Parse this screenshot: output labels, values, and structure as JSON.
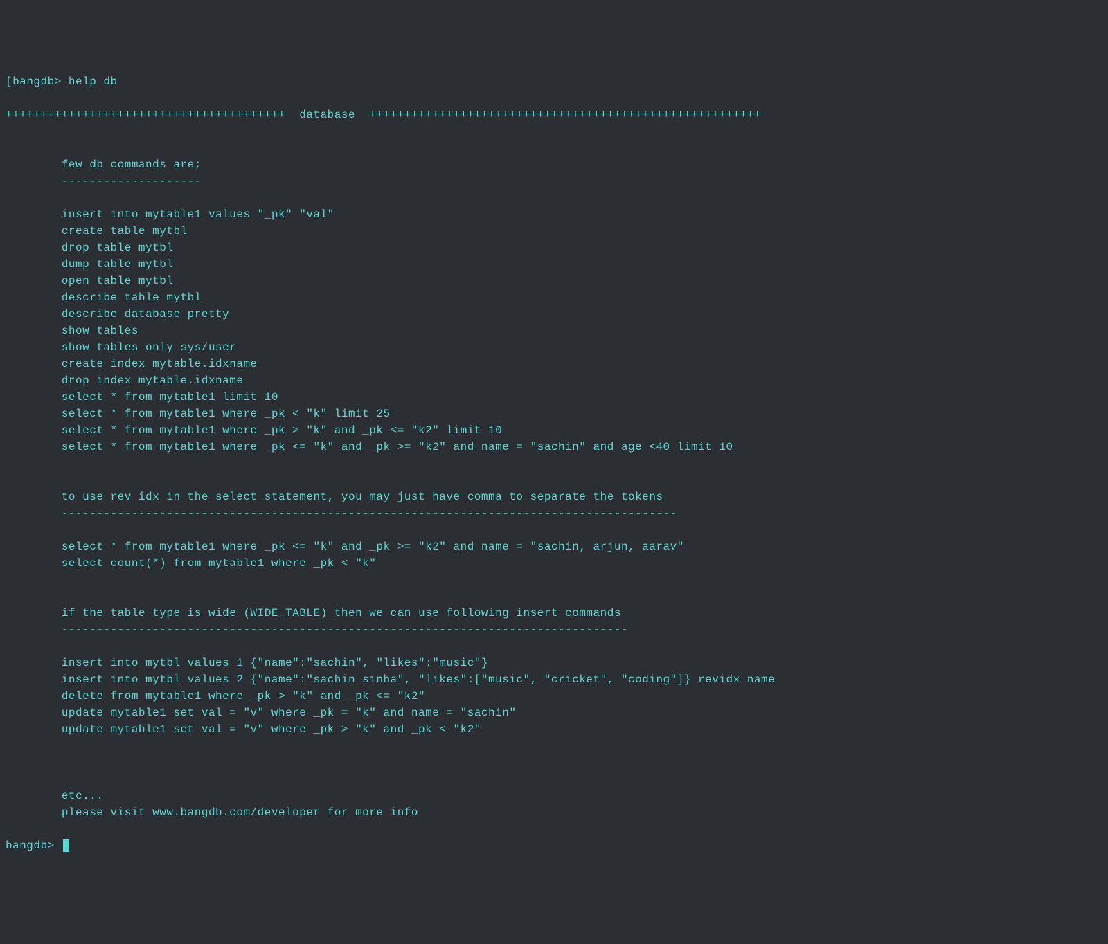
{
  "terminal": {
    "prompt_bracket": "[",
    "prompt_prefix": "bangdb> ",
    "command": "help db",
    "section_header": "++++++++++++++++++++++++++++++++++++++++  database  ++++++++++++++++++++++++++++++++++++++++++++++++++++++++",
    "intro_line": "        few db commands are;",
    "intro_dashes": "        --------------------",
    "commands_block1": [
      "        insert into mytable1 values \"_pk\" \"val\"",
      "        create table mytbl",
      "        drop table mytbl",
      "        dump table mytbl",
      "        open table mytbl",
      "        describe table mytbl",
      "        describe database pretty",
      "        show tables",
      "        show tables only sys/user",
      "        create index mytable.idxname",
      "        drop index mytable.idxname",
      "        select * from mytable1 limit 10",
      "        select * from mytable1 where _pk < \"k\" limit 25",
      "        select * from mytable1 where _pk > \"k\" and _pk <= \"k2\" limit 10",
      "        select * from mytable1 where _pk <= \"k\" and _pk >= \"k2\" and name = \"sachin\" and age <40 limit 10"
    ],
    "note2": "        to use rev idx in the select statement, you may just have comma to separate the tokens",
    "note2_dashes": "        ----------------------------------------------------------------------------------------",
    "commands_block2": [
      "        select * from mytable1 where _pk <= \"k\" and _pk >= \"k2\" and name = \"sachin, arjun, aarav\"",
      "        select count(*) from mytable1 where _pk < \"k\""
    ],
    "note3": "        if the table type is wide (WIDE_TABLE) then we can use following insert commands",
    "note3_dashes": "        ---------------------------------------------------------------------------------",
    "commands_block3": [
      "        insert into mytbl values 1 {\"name\":\"sachin\", \"likes\":\"music\"}",
      "        insert into mytbl values 2 {\"name\":\"sachin sinha\", \"likes\":[\"music\", \"cricket\", \"coding\"]} revidx name",
      "        delete from mytable1 where _pk > \"k\" and _pk <= \"k2\"",
      "        update mytable1 set val = \"v\" where _pk = \"k\" and name = \"sachin\"",
      "        update mytable1 set val = \"v\" where _pk > \"k\" and _pk < \"k2\""
    ],
    "etc_line": "        etc...",
    "footer_line": "        please visit www.bangdb.com/developer for more info",
    "prompt2_prefix": "bangdb> "
  }
}
